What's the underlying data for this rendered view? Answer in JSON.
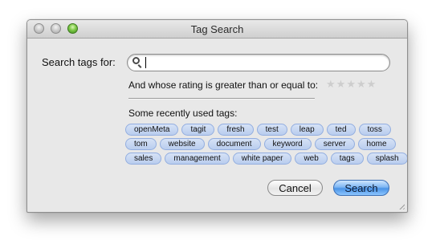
{
  "window": {
    "title": "Tag Search"
  },
  "search": {
    "label": "Search tags for:",
    "value": "",
    "placeholder": ""
  },
  "rating": {
    "label": "And whose rating is greater than or equal to:",
    "stars_total": 5,
    "stars_selected": 0,
    "star_glyph": "★"
  },
  "recent": {
    "label": "Some recently used tags:",
    "tag_rows": [
      [
        "openMeta",
        "tagit",
        "fresh",
        "test",
        "leap",
        "ted",
        "toss"
      ],
      [
        "tom",
        "website",
        "document",
        "keyword",
        "server",
        "home"
      ],
      [
        "sales",
        "management",
        "white paper",
        "web",
        "tags",
        "splash"
      ]
    ]
  },
  "buttons": {
    "cancel": "Cancel",
    "search": "Search"
  },
  "colors": {
    "tag_fill": "#c7d7f2",
    "tag_border": "#93aee0",
    "default_button": "#4a93e6",
    "zoom_light": "#7dc847"
  }
}
